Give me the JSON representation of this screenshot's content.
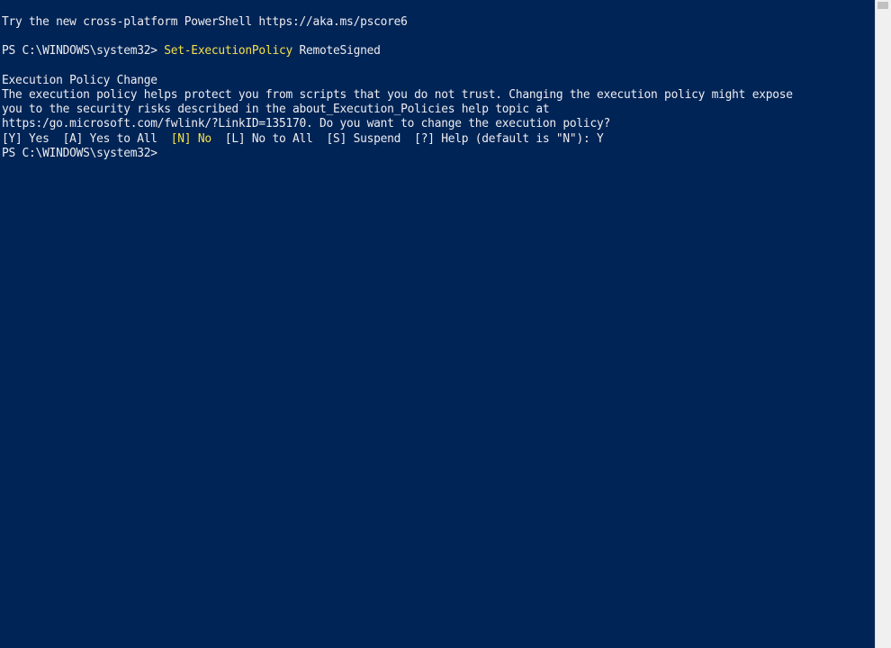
{
  "console": {
    "top_partial": "  ",
    "lines": [
      {
        "text": "Try the new cross-platform PowerShell https://aka.ms/pscore6"
      },
      {
        "text": ""
      },
      {
        "prompt": "PS C:\\WINDOWS\\system32> ",
        "command": "Set-ExecutionPolicy",
        "args": " RemoteSigned"
      },
      {
        "text": ""
      },
      {
        "text": "Execution Policy Change"
      },
      {
        "text": "The execution policy helps protect you from scripts that you do not trust. Changing the execution policy might expose"
      },
      {
        "text": "you to the security risks described in the about_Execution_Policies help topic at"
      },
      {
        "text": "https:/go.microsoft.com/fwlink/?LinkID=135170. Do you want to change the execution policy?"
      },
      {
        "choices_before": "[Y] Yes  [A] Yes to All  ",
        "default_choice": "[N] No",
        "choices_after": "  [L] No to All  [S] Suspend  [?] Help (default is \"N\"): Y"
      },
      {
        "prompt": "PS C:\\WINDOWS\\system32> "
      }
    ]
  },
  "colors": {
    "background": "#012456",
    "foreground": "#eeedf0",
    "command": "#f5e04a"
  }
}
